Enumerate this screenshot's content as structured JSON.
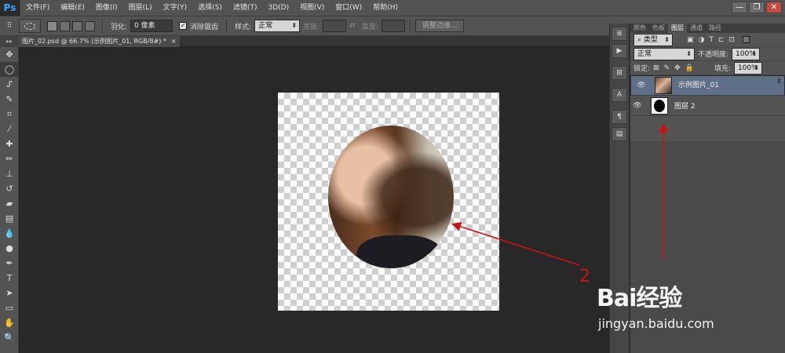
{
  "app": {
    "logo": "Ps"
  },
  "menu": [
    "文件(F)",
    "编辑(E)",
    "图像(I)",
    "图层(L)",
    "文字(Y)",
    "选择(S)",
    "滤镜(T)",
    "3D(D)",
    "视图(V)",
    "窗口(W)",
    "帮助(H)"
  ],
  "window_controls": {
    "minimize": "—",
    "restore": "❐",
    "close": "✕"
  },
  "options": {
    "feather_label": "羽化:",
    "feather_value": "0 像素",
    "antialias_label": "消除锯齿",
    "style_label": "样式:",
    "style_value": "正常",
    "width_label": "宽度:",
    "height_label": "高度:",
    "refine_edge_label": "调整边缘..."
  },
  "document_tab": {
    "title": "图片_02.psd @ 66.7% (示例图片_01, RGB/8#) *",
    "close": "×"
  },
  "panel": {
    "tabs": [
      "颜色",
      "色板",
      "图层",
      "通道",
      "路径"
    ],
    "active_tab": "图层",
    "filter_value": "类型",
    "blend_mode": "正常",
    "opacity_label": "不透明度:",
    "opacity_value": "100%",
    "lock_label": "锁定:",
    "fill_label": "填充:",
    "fill_value": "100%",
    "layers": [
      {
        "name": "示例图片_01",
        "selected": true
      },
      {
        "name": "图层 2",
        "selected": false
      }
    ]
  },
  "annotation": {
    "number": "2",
    "color": "#cc1111"
  },
  "watermark": {
    "brand": "Bai经验",
    "url": "jingyan.baidu.com"
  }
}
